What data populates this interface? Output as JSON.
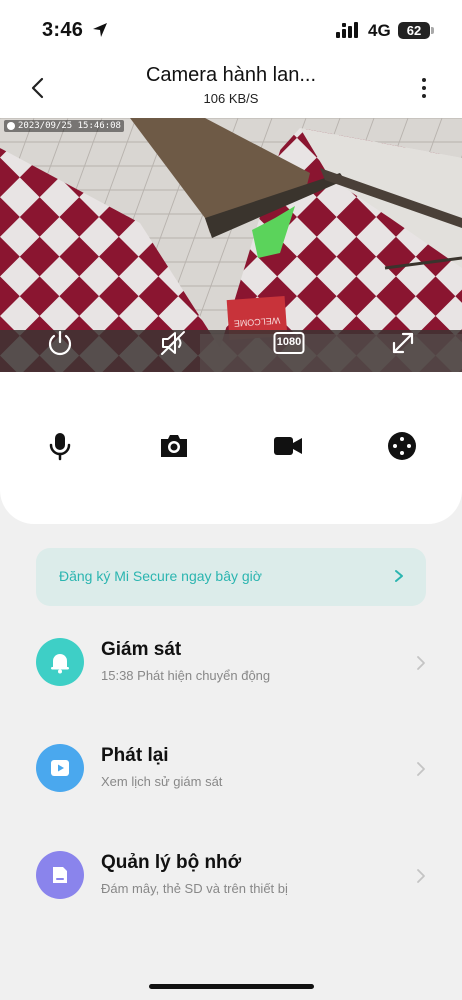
{
  "status_bar": {
    "time": "3:46",
    "network": "4G",
    "battery": "62"
  },
  "nav": {
    "title": "Camera hành lan...",
    "subtitle": "106 KB/S"
  },
  "camera": {
    "timestamp": "2023/09/25 15:46:08",
    "resolution_label": "1080",
    "sign_text": "WELCOME"
  },
  "promo": {
    "text": "Đăng ký Mi Secure ngay bây giờ"
  },
  "menu": [
    {
      "title": "Giám sát",
      "subtitle": "15:38 Phát hiện chuyển động",
      "color": "#3ecfc6",
      "icon": "bell-icon"
    },
    {
      "title": "Phát lại",
      "subtitle": "Xem lịch sử giám sát",
      "color": "#4aa8ee",
      "icon": "play-icon"
    },
    {
      "title": "Quản lý bộ nhớ",
      "subtitle": "Đám mây, thẻ SD và trên thiết bị",
      "color": "#8a84ec",
      "icon": "sd-card-icon"
    }
  ],
  "colors": {
    "accent_teal": "#2bb5b0",
    "promo_bg": "#dcecea",
    "page_bg": "#f0f0f0"
  }
}
